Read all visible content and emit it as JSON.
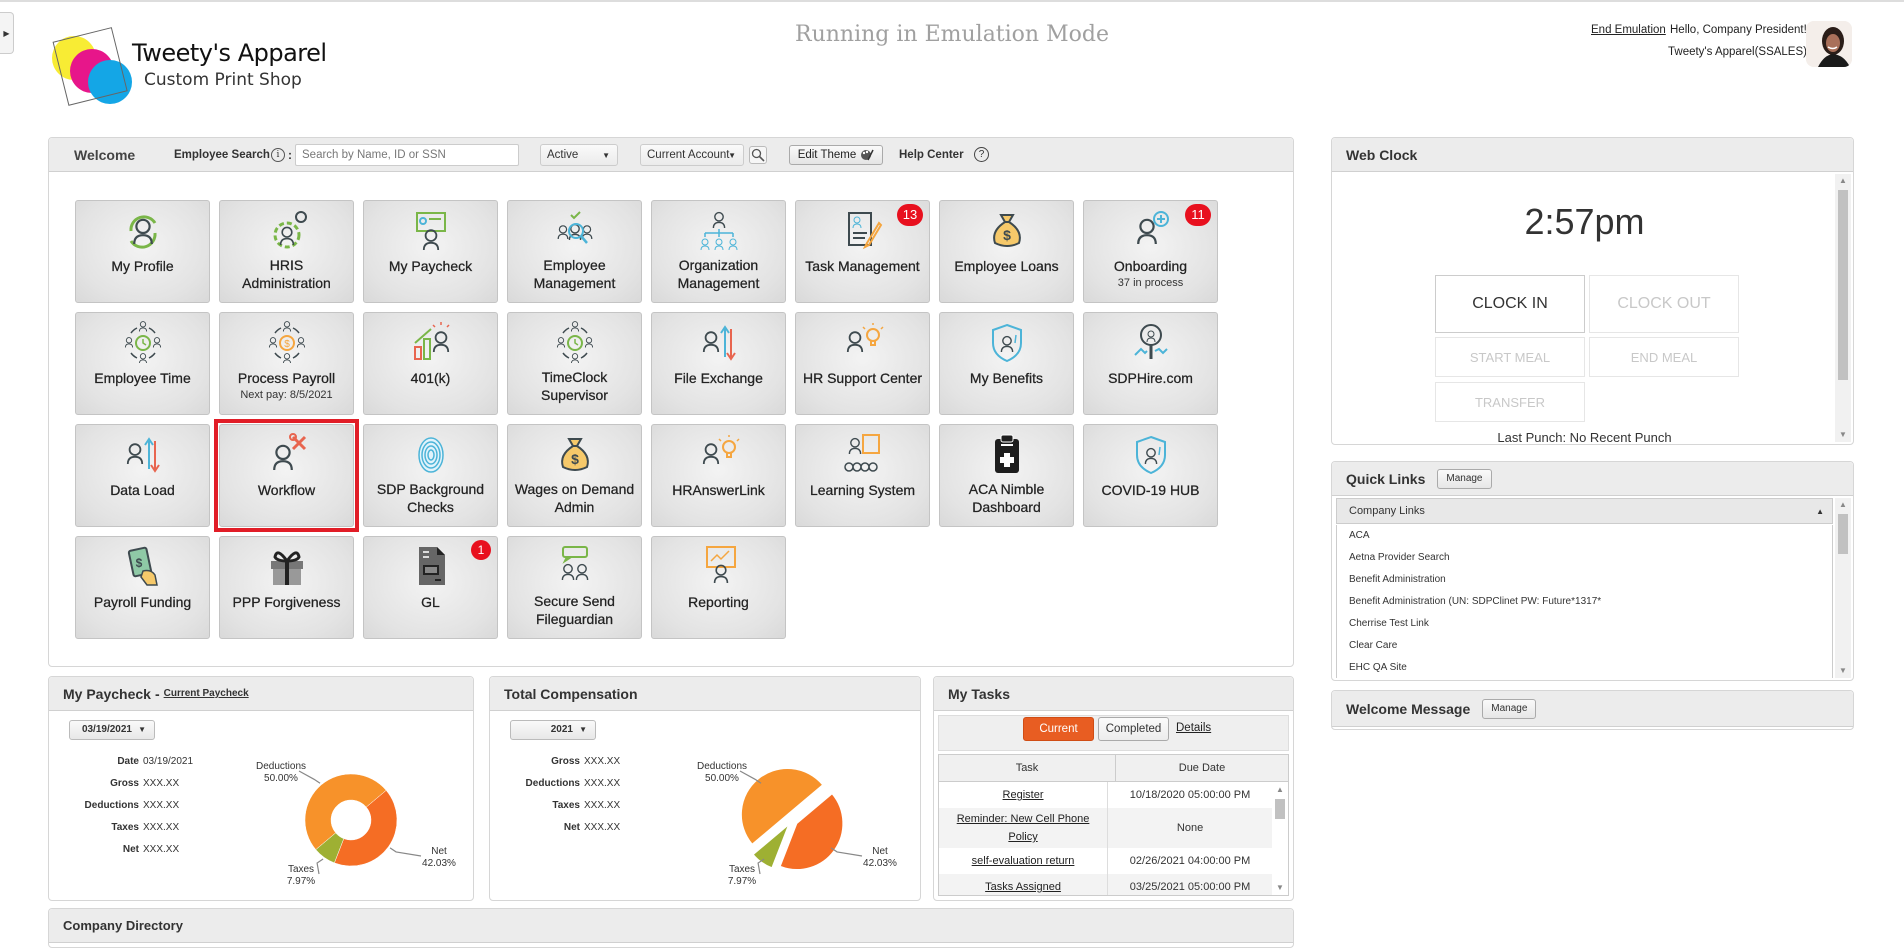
{
  "header": {
    "logo_title": "Tweety's Apparel",
    "logo_subtitle": "Custom Print Shop",
    "emulation_banner": "Running in Emulation Mode",
    "end_emulation": "End Emulation",
    "greeting": "Hello, Company President!",
    "account": "Tweety's Apparel(SSALES)"
  },
  "toolbar": {
    "welcome": "Welcome",
    "employee_search_label": "Employee Search",
    "colon": ":",
    "search_placeholder": "Search by Name, ID or SSN",
    "status_select": "Active",
    "account_select": "Current Account",
    "edit_theme": "Edit Theme",
    "help_center": "Help Center",
    "help_icon_glyph": "?",
    "info_icon_glyph": "i",
    "dropdown_arrow": "▼"
  },
  "tiles": [
    {
      "label": "My Profile",
      "icon": "profile-icon"
    },
    {
      "label": "HRIS Administration",
      "icon": "hris-gear-icon"
    },
    {
      "label": "My Paycheck",
      "icon": "paycheck-board-icon"
    },
    {
      "label": "Employee Management",
      "icon": "employee-search-icon"
    },
    {
      "label": "Organization Management",
      "icon": "org-chart-icon"
    },
    {
      "label": "Task Management",
      "icon": "task-document-icon",
      "badge": "13"
    },
    {
      "label": "Employee Loans",
      "icon": "money-bag-icon"
    },
    {
      "label": "Onboarding",
      "icon": "onboarding-add-icon",
      "badge": "11",
      "sub": "37 in process"
    },
    {
      "label": "Employee Time",
      "icon": "team-clock-icon"
    },
    {
      "label": "Process Payroll",
      "icon": "team-dollar-icon",
      "sub": "Next pay: 8/5/2021"
    },
    {
      "label": "401(k)",
      "icon": "growth-chart-icon"
    },
    {
      "label": "TimeClock Supervisor",
      "icon": "team-clock-icon"
    },
    {
      "label": "File Exchange",
      "icon": "file-exchange-icon"
    },
    {
      "label": "HR Support Center",
      "icon": "idea-person-icon"
    },
    {
      "label": "My Benefits",
      "icon": "benefits-shield-icon"
    },
    {
      "label": "SDPHire.com",
      "icon": "hire-search-icon"
    },
    {
      "label": "Data Load",
      "icon": "data-load-icon"
    },
    {
      "label": "Workflow",
      "icon": "workflow-tools-icon"
    },
    {
      "label": "SDP Background Checks",
      "icon": "fingerprint-icon"
    },
    {
      "label": "Wages on Demand Admin",
      "icon": "money-bag-icon"
    },
    {
      "label": "HRAnswerLink",
      "icon": "idea-person-icon"
    },
    {
      "label": "Learning System",
      "icon": "training-class-icon"
    },
    {
      "label": "ACA Nimble Dashboard",
      "icon": "medical-clipboard-icon"
    },
    {
      "label": "COVID-19 HUB",
      "icon": "covid-shield-icon"
    },
    {
      "label": "Payroll Funding",
      "icon": "cash-hand-icon"
    },
    {
      "label": "PPP Forgiveness",
      "icon": "gift-icon"
    },
    {
      "label": "GL",
      "icon": "gl-document-icon",
      "badge": "1"
    },
    {
      "label": "Secure Send Fileguardian",
      "icon": "secure-chat-icon"
    },
    {
      "label": "Reporting",
      "icon": "report-presenter-icon"
    }
  ],
  "highlighted_tile": "Workflow",
  "web_clock": {
    "title": "Web Clock",
    "time": "2:57pm",
    "clock_in": "CLOCK IN",
    "clock_out": "CLOCK OUT",
    "start_meal": "START MEAL",
    "end_meal": "END MEAL",
    "transfer": "TRANSFER",
    "last_punch": "Last Punch: No Recent Punch"
  },
  "quick_links": {
    "title": "Quick Links",
    "manage": "Manage",
    "group": "Company Links",
    "items": [
      "ACA",
      "Aetna Provider Search",
      "Benefit Administration",
      "Benefit Administration (UN: SDPClinet PW: Future*1317*",
      "Cherrise Test Link",
      "Clear Care",
      "EHC QA Site"
    ]
  },
  "welcome_message": {
    "title": "Welcome Message",
    "manage": "Manage"
  },
  "my_paycheck": {
    "title": "My Paycheck",
    "separator": "-",
    "link": "Current Paycheck",
    "selected_date": "03/19/2021",
    "fields": [
      {
        "k": "Date",
        "v": "03/19/2021"
      },
      {
        "k": "Gross",
        "v": "XXX.XX"
      },
      {
        "k": "Deductions",
        "v": "XXX.XX"
      },
      {
        "k": "Taxes",
        "v": "XXX.XX"
      },
      {
        "k": "Net",
        "v": "XXX.XX"
      }
    ]
  },
  "total_compensation": {
    "title": "Total Compensation",
    "selected_year": "2021",
    "fields": [
      {
        "k": "Gross",
        "v": "XXX.XX"
      },
      {
        "k": "Deductions",
        "v": "XXX.XX"
      },
      {
        "k": "Taxes",
        "v": "XXX.XX"
      },
      {
        "k": "Net",
        "v": "XXX.XX"
      }
    ]
  },
  "chart_data": [
    {
      "type": "pie",
      "variant": "donut",
      "title": "My Paycheck",
      "categories": [
        "Deductions",
        "Net",
        "Taxes"
      ],
      "values": [
        50.0,
        42.03,
        7.97
      ],
      "labels": [
        "50.00%",
        "42.03%",
        "7.97%"
      ],
      "colors": [
        "#f7922a",
        "#f56d24",
        "#9eb033"
      ]
    },
    {
      "type": "pie",
      "variant": "exploded",
      "title": "Total Compensation",
      "categories": [
        "Deductions",
        "Net",
        "Taxes"
      ],
      "values": [
        50.0,
        42.03,
        7.97
      ],
      "labels": [
        "50.00%",
        "42.03%",
        "7.97%"
      ],
      "colors": [
        "#f7922a",
        "#f56d24",
        "#9eb033"
      ]
    }
  ],
  "my_tasks": {
    "title": "My Tasks",
    "tab_current": "Current",
    "tab_completed": "Completed",
    "details": "Details",
    "col_task": "Task",
    "col_due": "Due Date",
    "rows": [
      {
        "task": "Register",
        "due": "10/18/2020 05:00:00 PM"
      },
      {
        "task": "Reminder: New Cell Phone Policy",
        "due": "None"
      },
      {
        "task": "self-evaluation return",
        "due": "02/26/2021 04:00:00 PM"
      },
      {
        "task": "Tasks Assigned",
        "due": "03/25/2021 05:00:00 PM"
      }
    ]
  },
  "company_directory": {
    "title": "Company Directory"
  },
  "colors": {
    "accent_orange": "#e85d22",
    "badge_red": "#e8101e",
    "highlight_red": "#e11d27"
  }
}
